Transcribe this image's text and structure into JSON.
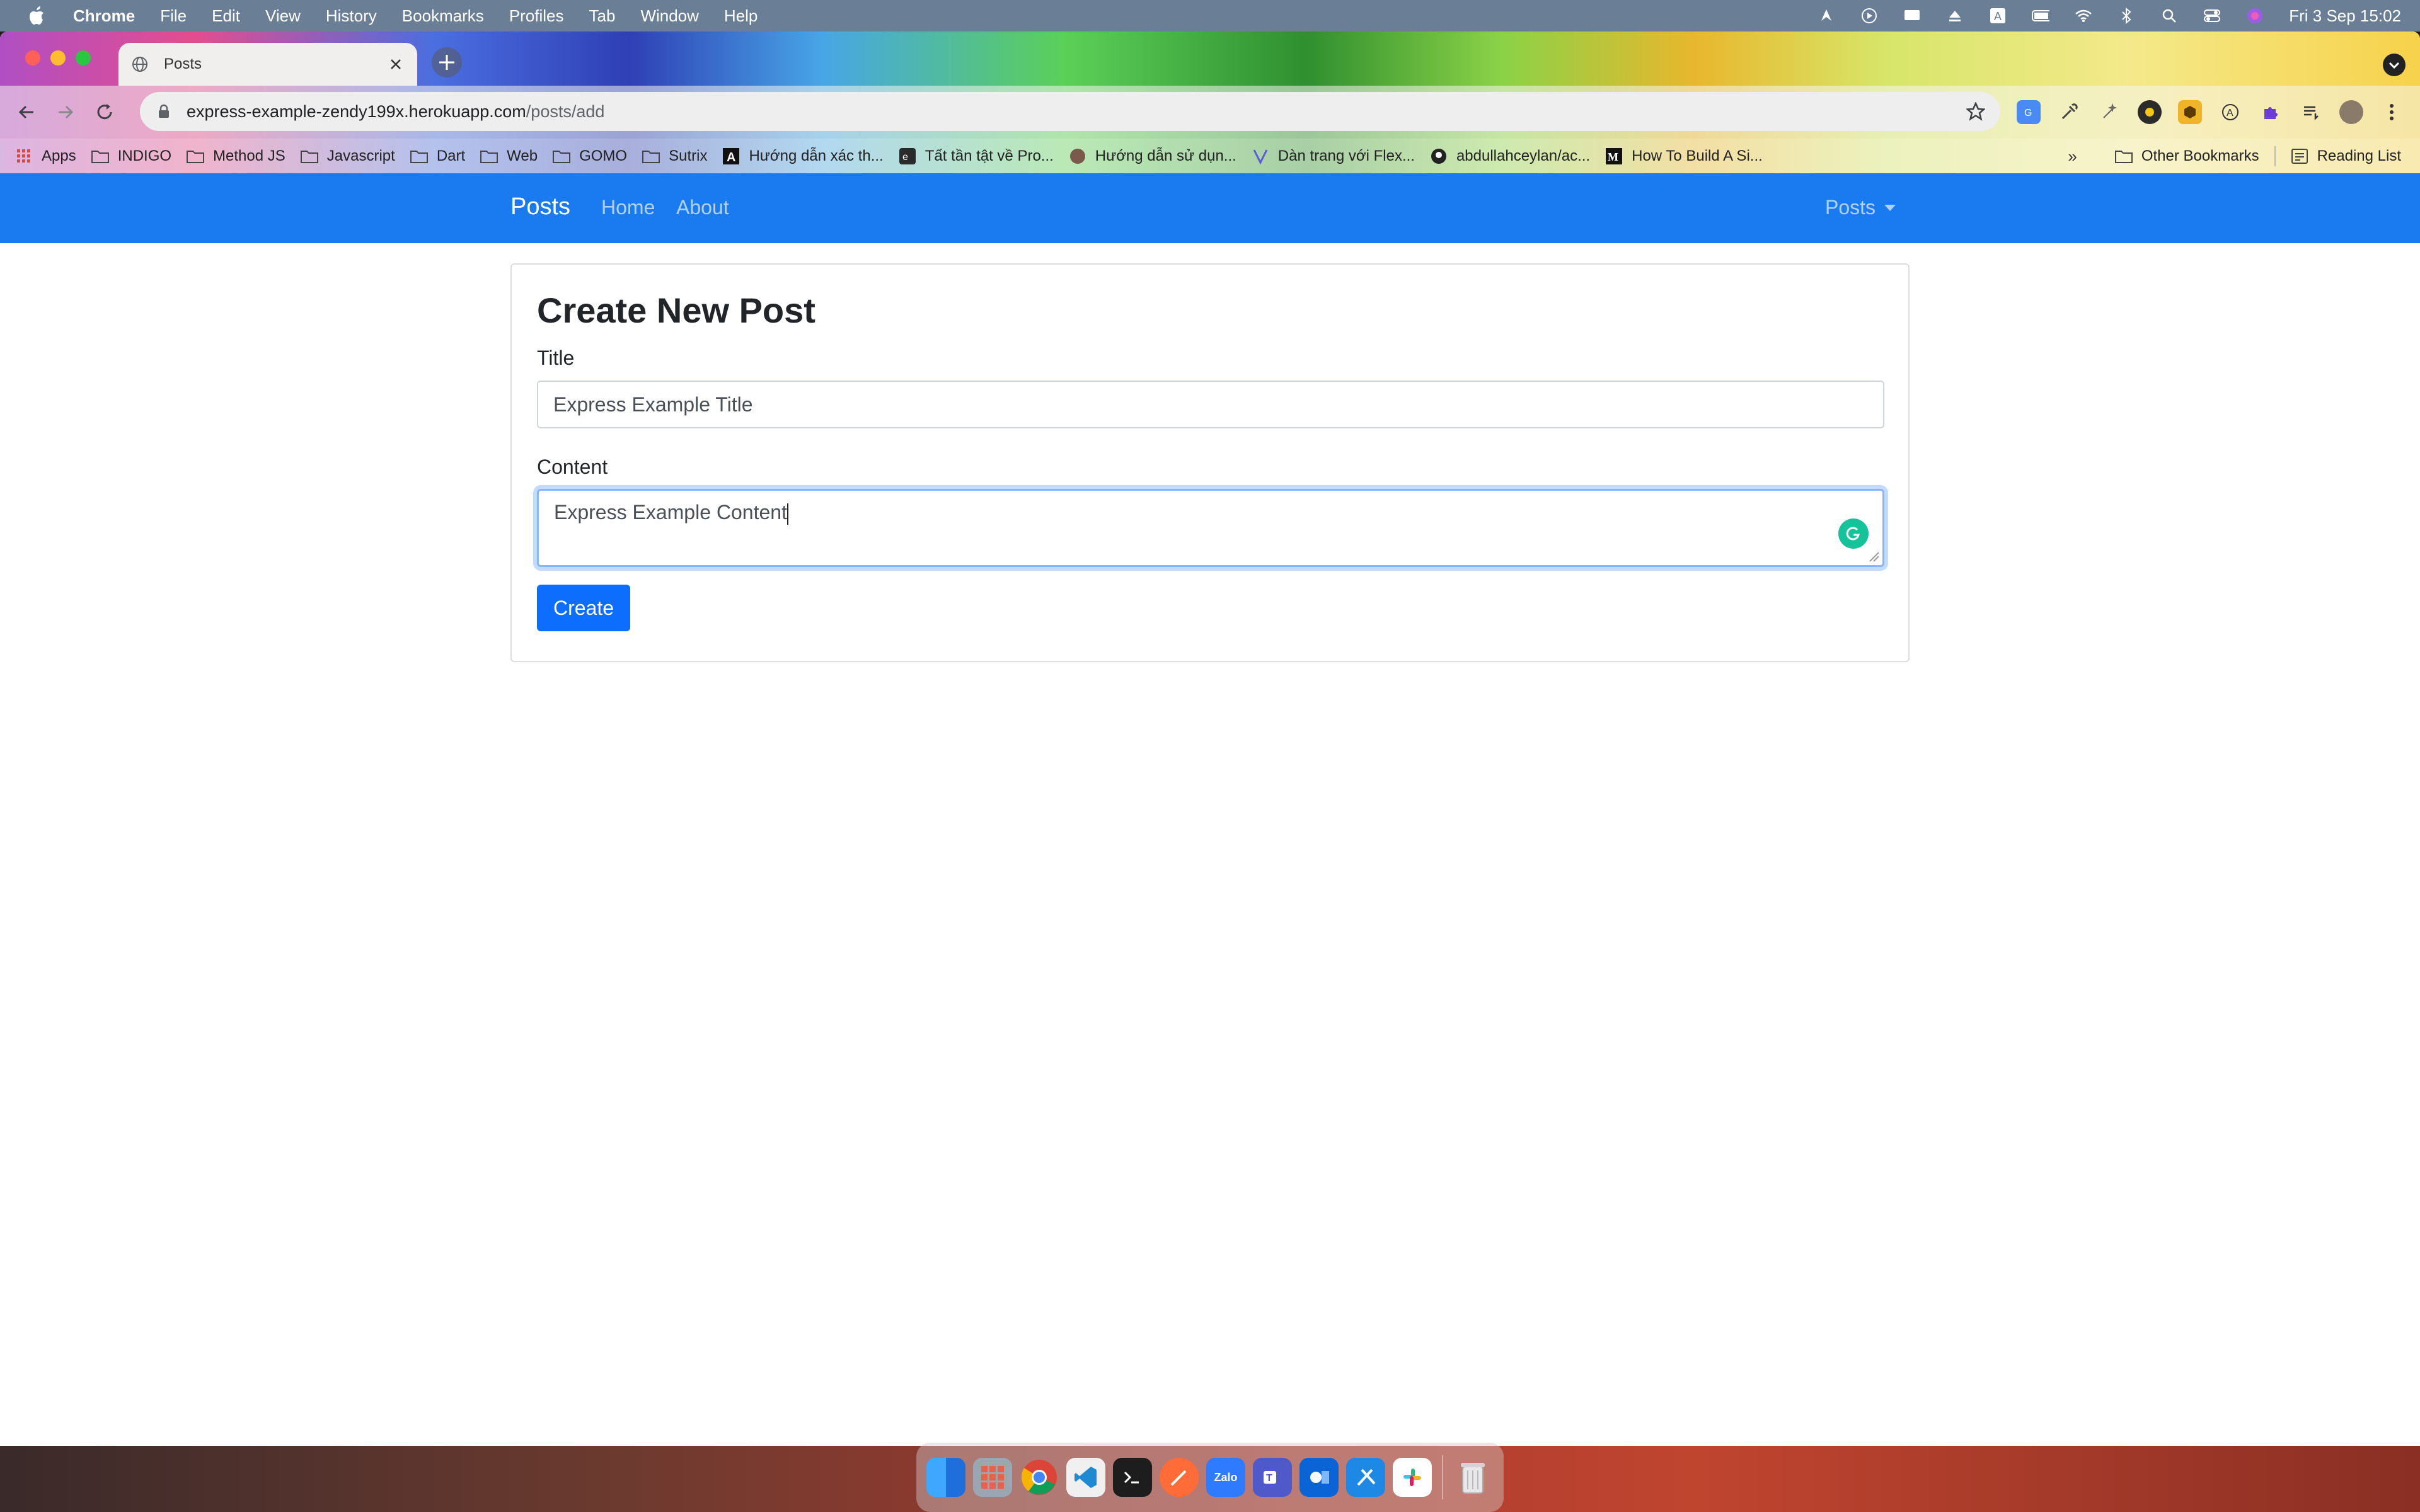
{
  "menubar": {
    "app": "Chrome",
    "items": [
      "File",
      "Edit",
      "View",
      "History",
      "Bookmarks",
      "Profiles",
      "Tab",
      "Window",
      "Help"
    ],
    "clock": "Fri 3 Sep  15:02"
  },
  "browser": {
    "tab_title": "Posts",
    "url_host": "express-example-zendy199x.herokuapp.com",
    "url_path": "/posts/add",
    "bookmarks": [
      "Apps",
      "INDIGO",
      "Method JS",
      "Javascript",
      "Dart",
      "Web",
      "GOMO",
      "Sutrix",
      "Hướng dẫn xác th...",
      "Tất tần tật về Pro...",
      "Hướng dẫn sử dụn...",
      "Dàn trang với Flex...",
      "abdullahceylan/ac...",
      "How To Build A Si..."
    ],
    "other_bookmarks": "Other Bookmarks",
    "reading_list": "Reading List"
  },
  "navbar": {
    "brand": "Posts",
    "links": [
      "Home",
      "About"
    ],
    "dropdown": "Posts"
  },
  "form": {
    "heading": "Create New Post",
    "title_label": "Title",
    "title_value": "Express Example Title",
    "content_label": "Content",
    "content_value": "Express Example Content",
    "submit": "Create"
  },
  "dock": {
    "apps": [
      "Finder",
      "Launchpad",
      "Chrome",
      "VS Code",
      "Terminal",
      "Postman",
      "Zalo",
      "Teams",
      "Outlook",
      "Xcode",
      "Slack",
      "Trash"
    ],
    "zalo_label": "Zalo"
  },
  "colors": {
    "navbar": "#1a7bf0",
    "primary_button": "#0d6efd",
    "grammarly": "#15c39a"
  }
}
